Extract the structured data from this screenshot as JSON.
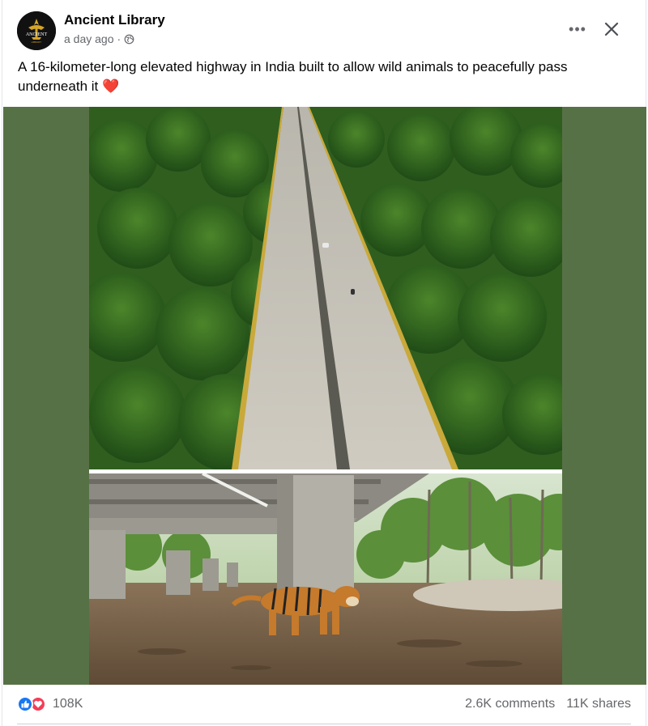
{
  "post": {
    "page_name": "Ancient Library",
    "timestamp": "a day ago",
    "separator": "·",
    "audience_icon": "globe-icon",
    "more_label": "•••",
    "close_icon": "close-icon",
    "text": "A 16-kilometer-long elevated highway in India built to allow wild animals to peacefully pass underneath it",
    "text_emoji": "❤️"
  },
  "avatar": {
    "logo_text_top": "ANCIENT",
    "logo_text_bottom": "LIBRARY",
    "bg_color": "#111111",
    "accent_color": "#d4a52a"
  },
  "media": {
    "background_color": "#577146",
    "images": [
      {
        "name": "elevated-highway-photo"
      },
      {
        "name": "tiger-under-bridge-photo"
      }
    ]
  },
  "engagement": {
    "reaction_icons": [
      "like-icon",
      "love-icon"
    ],
    "reaction_count": "108K",
    "comments": "2.6K comments",
    "shares": "11K shares"
  }
}
